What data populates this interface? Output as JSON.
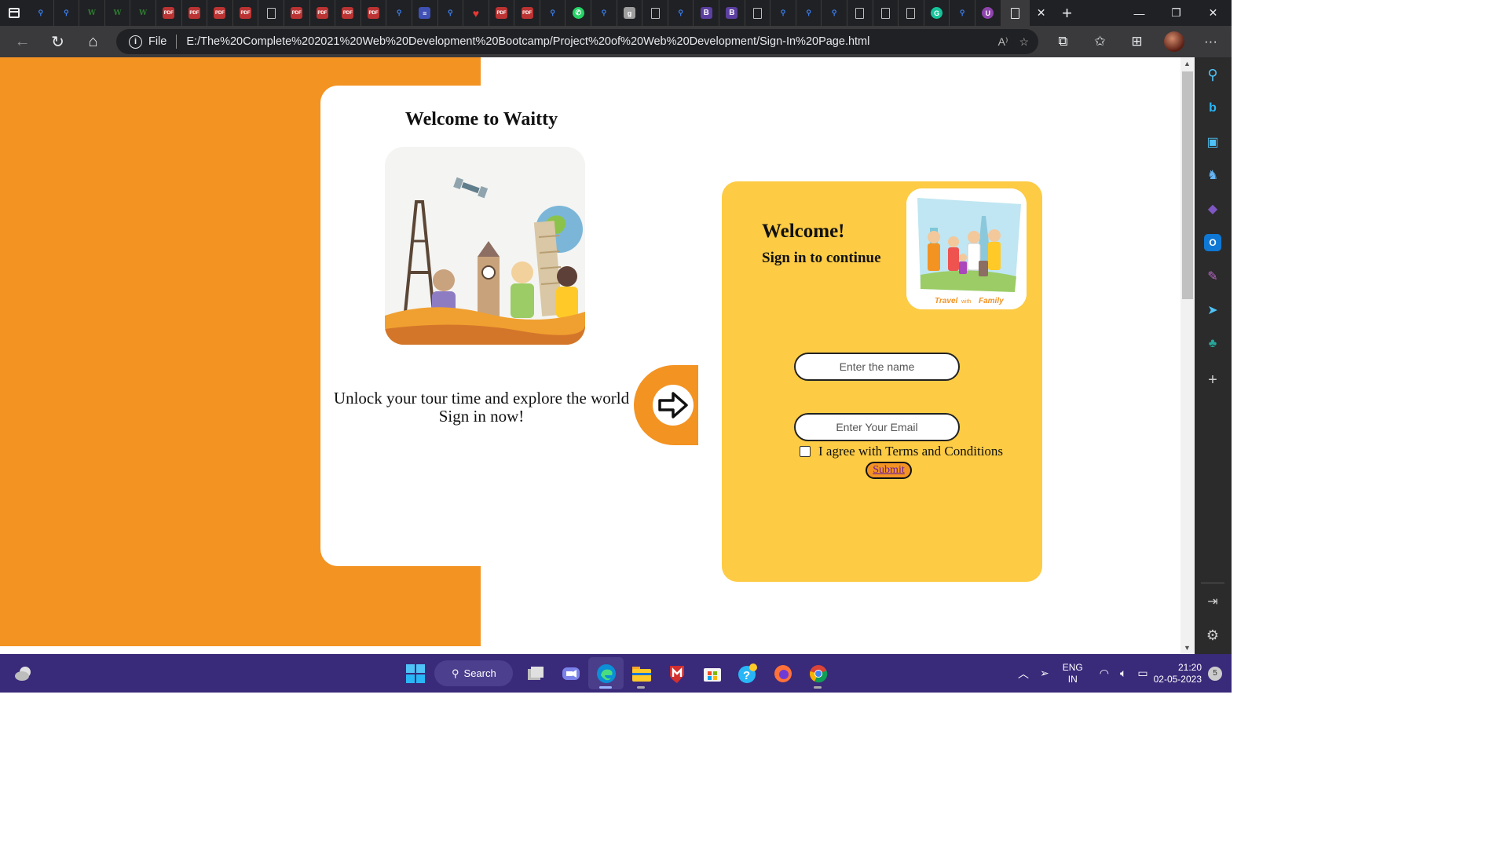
{
  "browser": {
    "tabs": [
      {
        "icon": "search-icon",
        "glyph": "⚲",
        "kind": "search"
      },
      {
        "icon": "search-icon",
        "glyph": "⚲",
        "kind": "search"
      },
      {
        "icon": "w-logo-icon",
        "glyph": "W",
        "kind": "w"
      },
      {
        "icon": "w-logo-icon",
        "glyph": "W",
        "kind": "w"
      },
      {
        "icon": "w-logo-icon",
        "glyph": "W",
        "kind": "w"
      },
      {
        "icon": "pdf-icon",
        "glyph": "PDF",
        "kind": "pdf"
      },
      {
        "icon": "pdf-icon",
        "glyph": "PDF",
        "kind": "pdf"
      },
      {
        "icon": "pdf-icon",
        "glyph": "PDF",
        "kind": "pdf"
      },
      {
        "icon": "pdf-icon",
        "glyph": "PDF",
        "kind": "pdf"
      },
      {
        "icon": "document-icon",
        "glyph": "",
        "kind": "doc"
      },
      {
        "icon": "pdf-icon",
        "glyph": "PDF",
        "kind": "pdf"
      },
      {
        "icon": "pdf-icon",
        "glyph": "PDF",
        "kind": "pdf"
      },
      {
        "icon": "pdf-icon",
        "glyph": "PDF",
        "kind": "pdf"
      },
      {
        "icon": "pdf-icon",
        "glyph": "PDF",
        "kind": "pdf"
      },
      {
        "icon": "search-icon",
        "glyph": "⚲",
        "kind": "search"
      },
      {
        "icon": "list-icon",
        "glyph": "≡",
        "kind": "list"
      },
      {
        "icon": "search-icon",
        "glyph": "⚲",
        "kind": "search"
      },
      {
        "icon": "heart-icon",
        "glyph": "♥",
        "kind": "heart"
      },
      {
        "icon": "pdf-icon",
        "glyph": "PDF",
        "kind": "pdf"
      },
      {
        "icon": "pdf-icon",
        "glyph": "PDF",
        "kind": "pdf"
      },
      {
        "icon": "search-icon",
        "glyph": "⚲",
        "kind": "search"
      },
      {
        "icon": "whatsapp-icon",
        "glyph": "✆",
        "kind": "wa"
      },
      {
        "icon": "search-icon",
        "glyph": "⚲",
        "kind": "search"
      },
      {
        "icon": "g-logo-icon",
        "glyph": "g",
        "kind": "g"
      },
      {
        "icon": "document-icon",
        "glyph": "",
        "kind": "doc"
      },
      {
        "icon": "search-icon",
        "glyph": "⚲",
        "kind": "search"
      },
      {
        "icon": "b-logo-icon",
        "glyph": "B",
        "kind": "b"
      },
      {
        "icon": "b-logo-icon",
        "glyph": "B",
        "kind": "b"
      },
      {
        "icon": "document-icon",
        "glyph": "",
        "kind": "doc"
      },
      {
        "icon": "search-icon",
        "glyph": "⚲",
        "kind": "search"
      },
      {
        "icon": "search-icon",
        "glyph": "⚲",
        "kind": "search"
      },
      {
        "icon": "search-icon",
        "glyph": "⚲",
        "kind": "search"
      },
      {
        "icon": "document-icon",
        "glyph": "",
        "kind": "doc"
      },
      {
        "icon": "document-icon",
        "glyph": "",
        "kind": "doc"
      },
      {
        "icon": "document-icon",
        "glyph": "",
        "kind": "doc"
      },
      {
        "icon": "grammarly-icon",
        "glyph": "G",
        "kind": "gr"
      },
      {
        "icon": "search-icon",
        "glyph": "⚲",
        "kind": "search"
      },
      {
        "icon": "u-logo-icon",
        "glyph": "U",
        "kind": "u"
      }
    ],
    "file_label": "File",
    "url": "E:/The%20Complete%202021%20Web%20Development%20Bootcamp/Project%20of%20Web%20Development/Sign-In%20Page.html"
  },
  "page": {
    "title": "Welcome to Waitty",
    "tagline_line1": "Unlock your tour time and explore the world",
    "tagline_line2": "Sign in now!",
    "welcome": "Welcome!",
    "signin_sub": "Sign in to continue",
    "family_caption_1": "Travel",
    "family_caption_2": "with",
    "family_caption_3": "Family",
    "name_placeholder": "Enter the name",
    "email_placeholder": "Enter Your Email",
    "terms_label": "I agree with Terms and Conditions",
    "submit_label": "Submit",
    "colors": {
      "orange": "#f39322",
      "yellow": "#fdcb44"
    }
  },
  "taskbar": {
    "search_label": "Search",
    "lang_line1": "ENG",
    "lang_line2": "IN",
    "time": "21:20",
    "date": "02-05-2023",
    "notification_count": "5"
  }
}
